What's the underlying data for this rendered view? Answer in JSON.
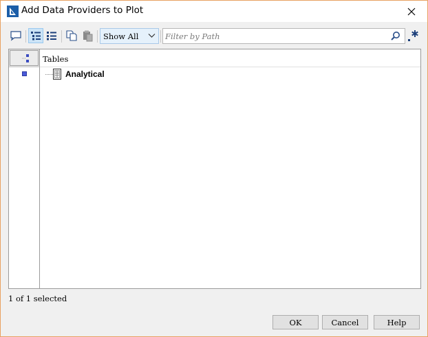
{
  "window": {
    "title": "Add Data Providers to Plot"
  },
  "toolbar": {
    "buttons": [
      {
        "icon": "comment-icon",
        "active": false
      },
      {
        "icon": "tree-view-icon",
        "active": true
      },
      {
        "icon": "list-view-icon",
        "active": false
      },
      {
        "icon": "copy-icon",
        "active": false
      },
      {
        "icon": "paste-icon",
        "active": false
      }
    ],
    "show_filter": {
      "selected": "Show All"
    },
    "path_filter": {
      "placeholder": "Filter by Path",
      "value": ""
    },
    "regex_label": ".*"
  },
  "table": {
    "column_header": "Tables",
    "rows": [
      {
        "label": "Analytical",
        "checked": true
      }
    ]
  },
  "status": {
    "text": "1 of 1 selected"
  },
  "buttons": {
    "ok": "OK",
    "cancel": "Cancel",
    "help": "Help"
  },
  "colors": {
    "accent": "#cce4f7",
    "check": "#4a5ad8",
    "window_border": "#e8a060"
  }
}
